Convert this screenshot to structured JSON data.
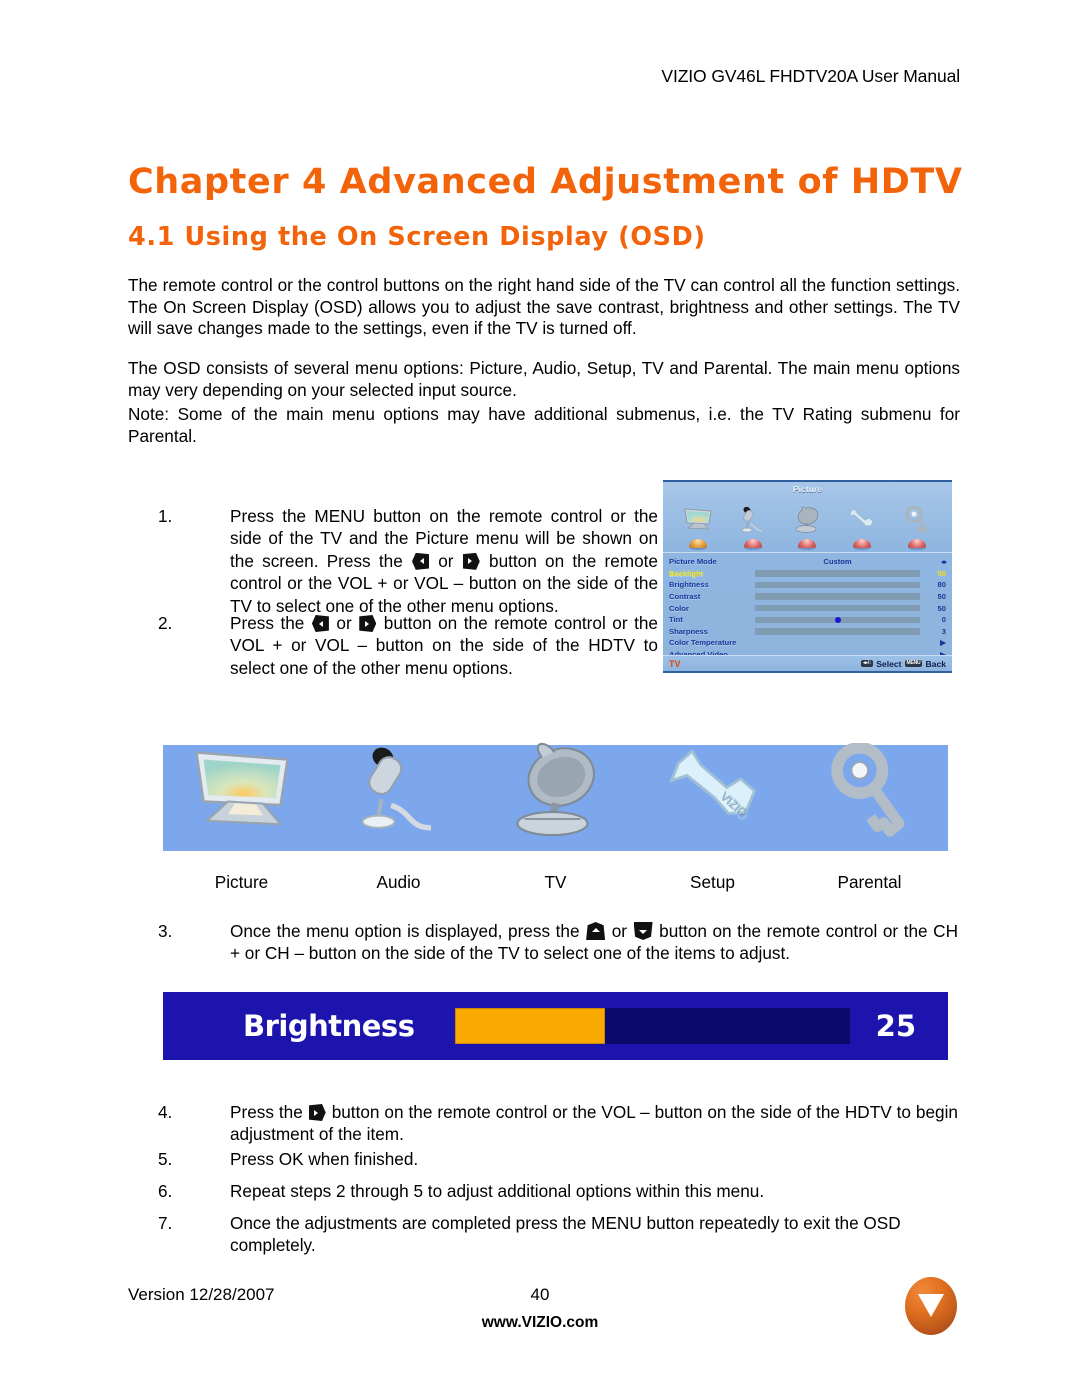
{
  "header": {
    "title": "VIZIO GV46L FHDTV20A User Manual"
  },
  "chapter": {
    "title": "Chapter 4 Advanced Adjustment of HDTV",
    "section": "4.1 Using the On Screen Display (OSD)",
    "accent_color": "#F2630A"
  },
  "paragraphs": {
    "p1": "The remote control or the control buttons on the right hand side of the TV can control all the function settings.  The On Screen Display (OSD) allows you to adjust the save contrast, brightness and other settings.  The TV will save changes made to the settings, even if the TV is turned off.",
    "p2": "The OSD consists of several menu options: Picture, Audio, Setup, TV and Parental.  The main menu options may very depending on your selected input source.",
    "p3": "Note:  Some of the main menu options may have additional submenus, i.e. the TV Rating submenu for Parental."
  },
  "steps": {
    "n1": "1.",
    "n2": "2.",
    "n3": "3.",
    "n4": "4.",
    "n5": "5.",
    "n6": "6.",
    "n7": "7.",
    "s1_a": "Press the MENU button on the remote control or the side of the TV and the Picture menu will be shown on the screen.   Press the",
    "s1_or": "or",
    "s1_b": "button on the remote control or the VOL + or VOL – button on the side of the TV to select one of the other menu options.",
    "s2_a": "Press the",
    "s2_or": "or",
    "s2_b": "button on the remote control or the VOL + or VOL – button on the side of the HDTV to select one of the other menu options.",
    "s3_a": "Once the menu option is displayed, press the",
    "s3_or": "or",
    "s3_b": "button on the remote control or the CH + or CH – button on the side of the TV to select one of the items to adjust.",
    "s4_a": "Press the",
    "s4_b": "button on the remote control or the VOL – button on the side of the HDTV to begin adjustment of the item.",
    "s5": "Press OK when finished.",
    "s6": "Repeat steps 2 through 5 to adjust additional options within this menu.",
    "s7": "Once the adjustments are completed press the MENU button repeatedly to exit the OSD completely."
  },
  "osd": {
    "title": "Picture",
    "tabs": [
      {
        "label": "Picture",
        "icon": "monitor-icon",
        "glyph": "▭",
        "active": true
      },
      {
        "label": "Audio",
        "icon": "microphone-icon",
        "glyph": "¡",
        "active": false
      },
      {
        "label": "TV",
        "icon": "satellite-dish-icon",
        "glyph": "◖",
        "active": false
      },
      {
        "label": "Setup",
        "icon": "wrench-icon",
        "glyph": "✂",
        "active": false
      },
      {
        "label": "Parental",
        "icon": "key-icon",
        "glyph": "⚿",
        "active": false
      }
    ],
    "rows": [
      {
        "label": "Picture Mode",
        "type": "text",
        "value": "Custom",
        "right": "◂▸",
        "selected": false
      },
      {
        "label": "Backlight",
        "type": "slider",
        "value": "50",
        "percent": 50,
        "fill": "yellow",
        "selected": true
      },
      {
        "label": "Brightness",
        "type": "slider",
        "value": "80",
        "percent": 80,
        "fill": "blue",
        "selected": false
      },
      {
        "label": "Contrast",
        "type": "slider",
        "value": "50",
        "percent": 50,
        "fill": "blue",
        "selected": false
      },
      {
        "label": "Color",
        "type": "slider",
        "value": "50",
        "percent": 50,
        "fill": "blue",
        "selected": false
      },
      {
        "label": "Tint",
        "type": "dot",
        "value": "0",
        "percent": 50,
        "fill": "blue",
        "selected": false
      },
      {
        "label": "Sharpness",
        "type": "slider",
        "value": "3",
        "percent": 42,
        "fill": "blue",
        "selected": false
      },
      {
        "label": "Color Temperature",
        "type": "arrow",
        "value": "▶",
        "selected": false
      },
      {
        "label": "Advanced Video",
        "type": "arrow",
        "value": "▶",
        "selected": false
      }
    ],
    "footer": {
      "source": "TV",
      "select_key": "◂▸/↕",
      "select_label": "Select",
      "back_key": "MENU",
      "back_label": "Back"
    }
  },
  "menu_icons": {
    "items": [
      {
        "label": "Picture",
        "icon": "monitor-icon",
        "glyph": "▭"
      },
      {
        "label": "Audio",
        "icon": "microphone-icon",
        "glyph": "¡"
      },
      {
        "label": "TV",
        "icon": "satellite-dish-icon",
        "glyph": "◖"
      },
      {
        "label": "Setup",
        "icon": "wrench-icon",
        "glyph": "✂"
      },
      {
        "label": "Parental",
        "icon": "key-icon",
        "glyph": "⚿"
      }
    ],
    "background_color": "#7da7ec"
  },
  "brightness_bar": {
    "label": "Brightness",
    "value": "25",
    "percent": 38,
    "bar_bg": "#1c14ad",
    "fill_color": "#f9a900",
    "track_color": "#0b0a6b"
  },
  "footer": {
    "version": "Version 12/28/2007",
    "page": "40",
    "url": "www.VIZIO.com",
    "logo": "vizio-logo"
  }
}
